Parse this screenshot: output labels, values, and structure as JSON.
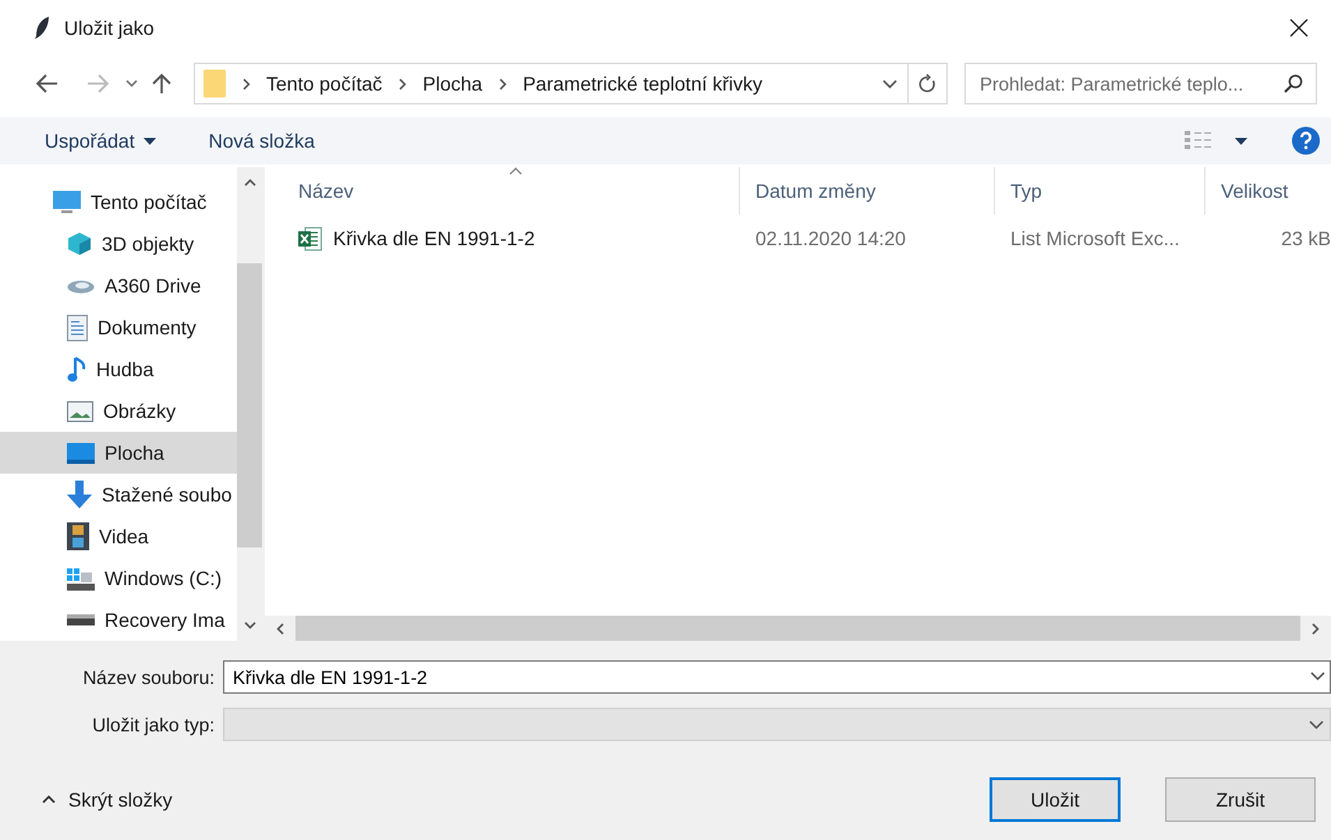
{
  "window": {
    "title": "Uložit jako"
  },
  "address": {
    "crumbs": [
      "Tento počítač",
      "Plocha",
      "Parametrické teplotní křivky"
    ]
  },
  "search": {
    "placeholder": "Prohledat: Parametrické teplo..."
  },
  "toolbar": {
    "organize": "Uspořádat",
    "new_folder": "Nová složka"
  },
  "sidebar": {
    "items": [
      {
        "label": "Tento počítač",
        "kind": "computer",
        "selected": false,
        "children": [
          {
            "label": "3D objekty",
            "kind": "cube",
            "selected": false
          },
          {
            "label": "A360 Drive",
            "kind": "cloud",
            "selected": false
          },
          {
            "label": "Dokumenty",
            "kind": "document",
            "selected": false
          },
          {
            "label": "Hudba",
            "kind": "music",
            "selected": false
          },
          {
            "label": "Obrázky",
            "kind": "image",
            "selected": false
          },
          {
            "label": "Plocha",
            "kind": "desktop",
            "selected": true
          },
          {
            "label": "Stažené soubo",
            "kind": "download",
            "selected": false
          },
          {
            "label": "Videa",
            "kind": "video",
            "selected": false
          },
          {
            "label": "Windows (C:)",
            "kind": "windows-drive",
            "selected": false
          },
          {
            "label": "Recovery Ima",
            "kind": "drive",
            "selected": false
          }
        ]
      }
    ]
  },
  "table": {
    "columns": [
      "Název",
      "Datum změny",
      "Typ",
      "Velikost"
    ],
    "rows": [
      {
        "name": "Křivka dle EN 1991-1-2",
        "date": "02.11.2020 14:20",
        "type": "List Microsoft Exc...",
        "size": "23 kB"
      }
    ]
  },
  "form": {
    "filename_label": "Název souboru:",
    "filename": "Křivka dle EN 1991-1-2",
    "type_label": "Uložit jako typ:"
  },
  "footer": {
    "hide_folders": "Skrýt složky",
    "save": "Uložit",
    "cancel": "Zrušit"
  }
}
